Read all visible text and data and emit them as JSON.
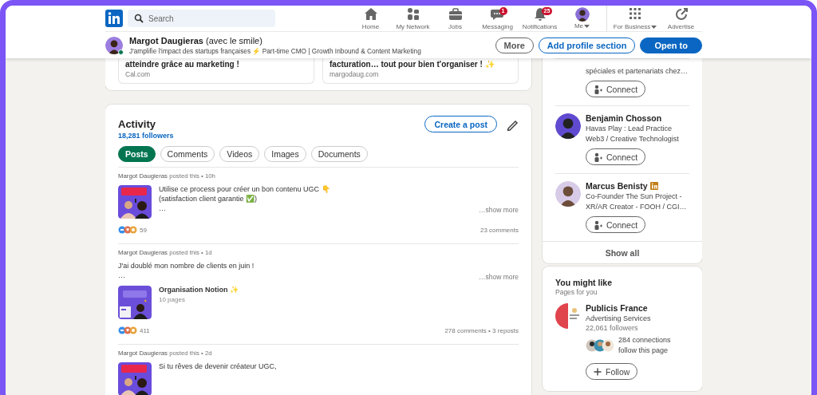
{
  "nav": {
    "search": {
      "placeholder": "Search"
    },
    "items": [
      {
        "kind": "home",
        "label": "Home"
      },
      {
        "kind": "network",
        "label": "My Network"
      },
      {
        "kind": "jobs",
        "label": "Jobs"
      },
      {
        "kind": "messaging",
        "label": "Messaging",
        "badge": "1"
      },
      {
        "kind": "notifications",
        "label": "Notifications",
        "badge": "25"
      },
      {
        "kind": "me",
        "label": "Me",
        "dropdown": true
      },
      {
        "kind": "business",
        "label": "For Business",
        "dropdown": true
      },
      {
        "kind": "advertise",
        "label": "Advertise"
      }
    ]
  },
  "profile_bar": {
    "name": "Margot Daugieras",
    "name_suffix": "(avec le smile)",
    "online": true,
    "headline": "J'amplifie l'impact des startups françaises ⚡ Part-time CMO | Growth Inbound & Content Marketing",
    "buttons": [
      {
        "kind": "secondary",
        "label": "More"
      },
      {
        "kind": "outline",
        "label": "Add profile section"
      },
      {
        "kind": "primary",
        "label": "Open to"
      }
    ]
  },
  "link_cards": [
    {
      "title": "atteindre grâce au marketing !",
      "domain": "Cal.com"
    },
    {
      "title": "facturation… tout pour bien t'organiser ! ✨",
      "domain": "margodaug.com"
    }
  ],
  "activity": {
    "title": "Activity",
    "followers": "18,281 followers",
    "create_button": "Create a post",
    "filters": [
      {
        "label": "Posts",
        "selected": true
      },
      {
        "label": "Comments",
        "selected": false
      },
      {
        "label": "Videos",
        "selected": false
      },
      {
        "label": "Images",
        "selected": false
      },
      {
        "label": "Documents",
        "selected": false
      }
    ],
    "posts": [
      {
        "kind": "media",
        "author": "Margot Daugieras",
        "meta": "posted this • 10h",
        "lines": [
          "Utilise ce process pour créer un bon contenu UGC 👇",
          "(satisfaction client garantie ✅)",
          "…"
        ],
        "show_more": "…show more",
        "reactions": "59",
        "stats": "23 comments"
      },
      {
        "kind": "document",
        "author": "Margot Daugieras",
        "meta": "posted this • 1d",
        "lines": [
          "J'ai doublé mon nombre de clients en juin !",
          "…"
        ],
        "show_more": "…show more",
        "document": {
          "title": "Organisation Notion ✨",
          "pages": "10 pages"
        },
        "reactions": "411",
        "stats": "278 comments • 3 reposts"
      },
      {
        "kind": "media",
        "author": "Margot Daugieras",
        "meta": "posted this • 2d",
        "lines": [
          "Si tu rêves de devenir créateur UGC,"
        ]
      }
    ]
  },
  "people": {
    "items": [
      {
        "headline": "spéciales et partenariats chez…",
        "connect": "Connect"
      },
      {
        "name": "Benjamin Chosson",
        "premium": false,
        "headline": "Havas Play : Lead Practice Web3 / Creative Technologist",
        "connect": "Connect"
      },
      {
        "name": "Marcus Benisty",
        "premium": true,
        "headline": "Co-Founder The Sun Project - XR/AR Creator - FOOH / CGI…",
        "connect": "Connect"
      }
    ],
    "show_all": "Show all"
  },
  "you_might_like": {
    "title": "You might like",
    "subtitle": "Pages for you",
    "page": {
      "name": "Publicis France",
      "category": "Advertising Services",
      "followers": "22,061 followers",
      "connections": "284 connections follow this page",
      "follow": "Follow"
    }
  }
}
